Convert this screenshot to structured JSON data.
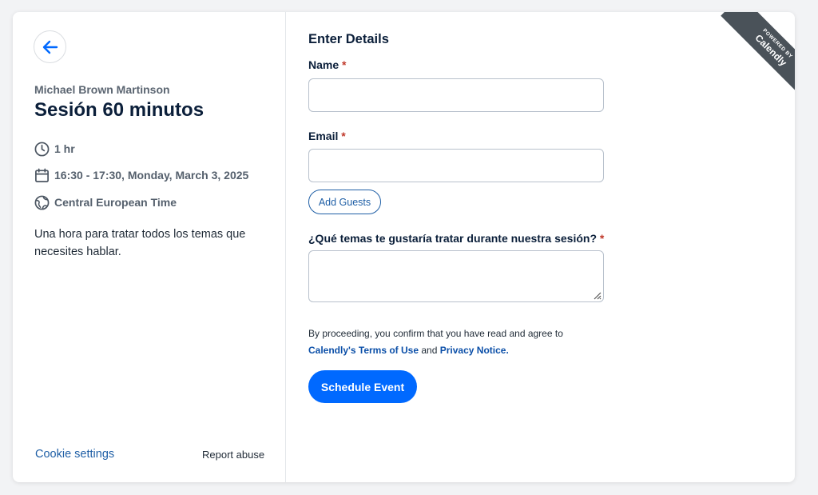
{
  "left_panel": {
    "organizer": "Michael Brown Martinson",
    "event_title": "Sesión 60 minutos",
    "duration": "1 hr",
    "datetime": "16:30 - 17:30, Monday, March 3, 2025",
    "timezone": "Central European Time",
    "description": "Una hora para tratar todos los temas que necesites hablar.",
    "cookie_settings": "Cookie settings",
    "report_abuse": "Report abuse"
  },
  "form": {
    "section_title": "Enter Details",
    "name_label": "Name",
    "email_label": "Email",
    "required_mark": "*",
    "name_value": "",
    "email_value": "",
    "add_guests": "Add Guests",
    "question_label": "¿Qué temas te gustaría tratar durante nuestra sesión?",
    "question_value": "",
    "consent_text": "By proceeding, you confirm that you have read and agree to",
    "terms_link": "Calendly's Terms of Use",
    "and_text": "and",
    "privacy_link": "Privacy Notice.",
    "submit": "Schedule Event"
  },
  "ribbon": {
    "powered_by": "POWERED BY",
    "brand": "Calendly"
  },
  "colors": {
    "accent": "#0069ff",
    "link": "#1f5fa6",
    "ribbon": "#4a5259",
    "title": "#0b1f3a"
  },
  "icons": [
    "arrow-left-icon",
    "clock-icon",
    "calendar-icon",
    "globe-icon",
    "resize-grip-icon"
  ]
}
